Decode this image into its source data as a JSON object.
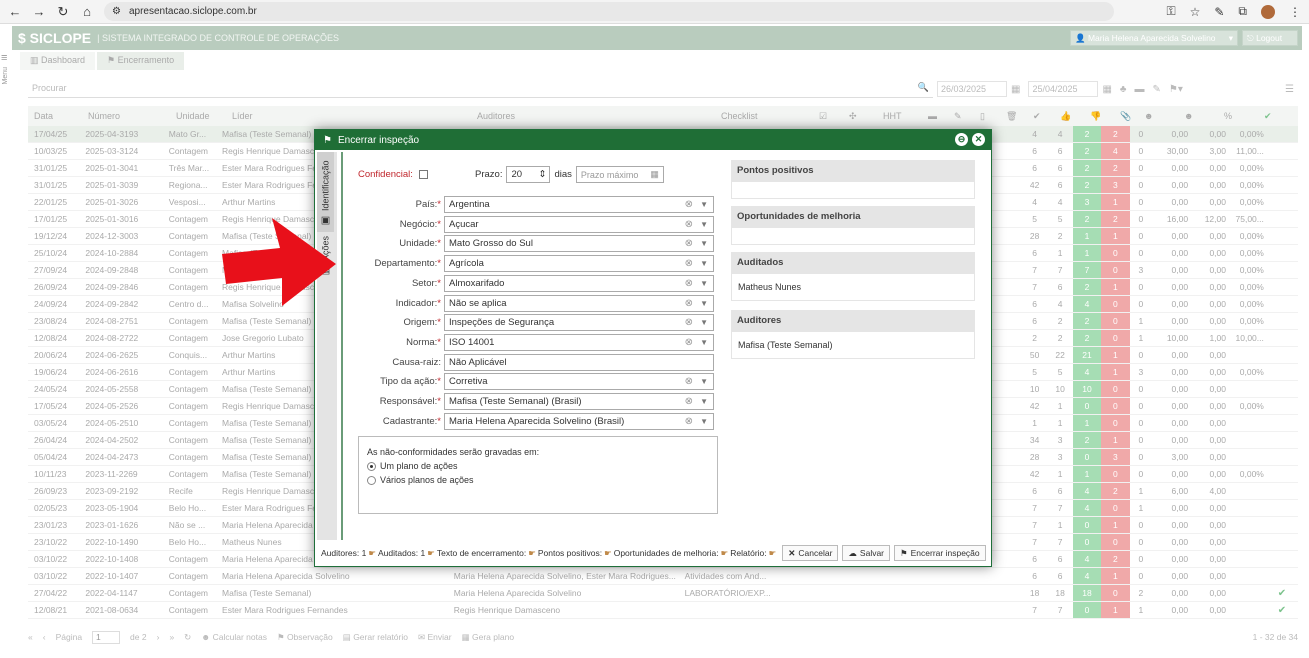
{
  "browser": {
    "url": "apresentacao.siclope.com.br"
  },
  "app": {
    "logo": "$ SICLOPE",
    "title": "| SISTEMA INTEGRADO DE CONTROLE DE OPERAÇÕES",
    "user": "Maria Helena Aparecida Solvelino",
    "logout": "Logout",
    "menu_label": "Menu"
  },
  "tabs": [
    {
      "label": "Dashboard"
    },
    {
      "label": "Encerramento"
    }
  ],
  "toolbar": {
    "search_placeholder": "Procurar",
    "date_from": "26/03/2025",
    "date_to": "25/04/2025"
  },
  "table": {
    "headers": {
      "data": "Data",
      "numero": "Número",
      "unidade": "Unidade",
      "lider": "Líder",
      "auditores": "Auditores",
      "checklist": "Checklist",
      "hht": "HHT",
      "pct": "%"
    },
    "rows": [
      {
        "data": "17/04/25",
        "num": "2025-04-3193",
        "uni": "Mato Gr...",
        "lid": "Mafisa (Teste Semanal)",
        "aud": "",
        "chk": "",
        "n1": "4",
        "n2": "4",
        "g": "2",
        "r": "2",
        "z": "0",
        "v1": "0,00",
        "v2": "0,00",
        "v3": "0,00%",
        "ok": ""
      },
      {
        "data": "10/03/25",
        "num": "2025-03-3124",
        "uni": "Contagem",
        "lid": "Regis Henrique Damasceno",
        "aud": "",
        "chk": "",
        "n1": "6",
        "n2": "6",
        "g": "2",
        "r": "4",
        "z": "0",
        "v1": "30,00",
        "v2": "3,00",
        "v3": "11,00...",
        "ok": ""
      },
      {
        "data": "31/01/25",
        "num": "2025-01-3041",
        "uni": "Três Mar...",
        "lid": "Ester Mara Rodrigues Fernandes",
        "aud": "",
        "chk": "",
        "n1": "6",
        "n2": "6",
        "g": "2",
        "r": "2",
        "z": "0",
        "v1": "0,00",
        "v2": "0,00",
        "v3": "0,00%",
        "ok": ""
      },
      {
        "data": "31/01/25",
        "num": "2025-01-3039",
        "uni": "Regiona...",
        "lid": "Ester Mara Rodrigues Fernandes",
        "aud": "",
        "chk": "",
        "n1": "42",
        "n2": "6",
        "g": "2",
        "r": "3",
        "z": "0",
        "v1": "0,00",
        "v2": "0,00",
        "v3": "0,00%",
        "ok": ""
      },
      {
        "data": "22/01/25",
        "num": "2025-01-3026",
        "uni": "Vesposi...",
        "lid": "Arthur Martins",
        "aud": "",
        "chk": "",
        "n1": "4",
        "n2": "4",
        "g": "3",
        "r": "1",
        "z": "0",
        "v1": "0,00",
        "v2": "0,00",
        "v3": "0,00%",
        "ok": ""
      },
      {
        "data": "17/01/25",
        "num": "2025-01-3016",
        "uni": "Contagem",
        "lid": "Regis Henrique Damasceno",
        "aud": "",
        "chk": "",
        "n1": "5",
        "n2": "5",
        "g": "2",
        "r": "2",
        "z": "0",
        "v1": "16,00",
        "v2": "12,00",
        "v3": "75,00...",
        "ok": ""
      },
      {
        "data": "19/12/24",
        "num": "2024-12-3003",
        "uni": "Contagem",
        "lid": "Mafisa (Teste Semanal)",
        "aud": "",
        "chk": "",
        "n1": "28",
        "n2": "2",
        "g": "1",
        "r": "1",
        "z": "0",
        "v1": "0,00",
        "v2": "0,00",
        "v3": "0,00%",
        "ok": ""
      },
      {
        "data": "25/10/24",
        "num": "2024-10-2884",
        "uni": "Contagem",
        "lid": "Mafisa (Teste Semanal)",
        "aud": "",
        "chk": "",
        "n1": "6",
        "n2": "1",
        "g": "1",
        "r": "0",
        "z": "0",
        "v1": "0,00",
        "v2": "0,00",
        "v3": "0,00%",
        "ok": ""
      },
      {
        "data": "27/09/24",
        "num": "2024-09-2848",
        "uni": "Contagem",
        "lid": "Mafisa (Teste Semanal)",
        "aud": "",
        "chk": "",
        "n1": "7",
        "n2": "7",
        "g": "7",
        "r": "0",
        "z": "3",
        "v1": "0,00",
        "v2": "0,00",
        "v3": "0,00%",
        "ok": ""
      },
      {
        "data": "26/09/24",
        "num": "2024-09-2846",
        "uni": "Contagem",
        "lid": "Regis Henrique Damasceno",
        "aud": "",
        "chk": "",
        "n1": "7",
        "n2": "6",
        "g": "2",
        "r": "1",
        "z": "0",
        "v1": "0,00",
        "v2": "0,00",
        "v3": "0,00%",
        "ok": ""
      },
      {
        "data": "24/09/24",
        "num": "2024-09-2842",
        "uni": "Centro d...",
        "lid": "Mafisa Solvelino",
        "aud": "",
        "chk": "",
        "n1": "6",
        "n2": "4",
        "g": "4",
        "r": "0",
        "z": "0",
        "v1": "0,00",
        "v2": "0,00",
        "v3": "0,00%",
        "ok": ""
      },
      {
        "data": "23/08/24",
        "num": "2024-08-2751",
        "uni": "Contagem",
        "lid": "Mafisa (Teste Semanal)",
        "aud": "",
        "chk": "",
        "n1": "6",
        "n2": "2",
        "g": "2",
        "r": "0",
        "z": "1",
        "v1": "0,00",
        "v2": "0,00",
        "v3": "0,00%",
        "ok": ""
      },
      {
        "data": "12/08/24",
        "num": "2024-08-2722",
        "uni": "Contagem",
        "lid": "Jose Gregorio Lubato",
        "aud": "",
        "chk": "",
        "n1": "2",
        "n2": "2",
        "g": "2",
        "r": "0",
        "z": "1",
        "v1": "10,00",
        "v2": "1,00",
        "v3": "10,00...",
        "ok": ""
      },
      {
        "data": "20/06/24",
        "num": "2024-06-2625",
        "uni": "Conquis...",
        "lid": "Arthur Martins",
        "aud": "",
        "chk": "",
        "n1": "50",
        "n2": "22",
        "g": "21",
        "r": "1",
        "z": "0",
        "v1": "0,00",
        "v2": "0,00",
        "v3": "",
        "ok": ""
      },
      {
        "data": "19/06/24",
        "num": "2024-06-2616",
        "uni": "Contagem",
        "lid": "Arthur Martins",
        "aud": "",
        "chk": "",
        "n1": "5",
        "n2": "5",
        "g": "4",
        "r": "1",
        "z": "3",
        "v1": "0,00",
        "v2": "0,00",
        "v3": "0,00%",
        "ok": ""
      },
      {
        "data": "24/05/24",
        "num": "2024-05-2558",
        "uni": "Contagem",
        "lid": "Mafisa (Teste Semanal)",
        "aud": "",
        "chk": "",
        "n1": "10",
        "n2": "10",
        "g": "10",
        "r": "0",
        "z": "0",
        "v1": "0,00",
        "v2": "0,00",
        "v3": "",
        "ok": ""
      },
      {
        "data": "17/05/24",
        "num": "2024-05-2526",
        "uni": "Contagem",
        "lid": "Regis Henrique Damasceno",
        "aud": "",
        "chk": "",
        "n1": "42",
        "n2": "1",
        "g": "0",
        "r": "0",
        "z": "0",
        "v1": "0,00",
        "v2": "0,00",
        "v3": "0,00%",
        "ok": ""
      },
      {
        "data": "03/05/24",
        "num": "2024-05-2510",
        "uni": "Contagem",
        "lid": "Mafisa (Teste Semanal)",
        "aud": "",
        "chk": "",
        "n1": "1",
        "n2": "1",
        "g": "1",
        "r": "0",
        "z": "0",
        "v1": "0,00",
        "v2": "0,00",
        "v3": "",
        "ok": ""
      },
      {
        "data": "26/04/24",
        "num": "2024-04-2502",
        "uni": "Contagem",
        "lid": "Mafisa (Teste Semanal)",
        "aud": "",
        "chk": "",
        "n1": "34",
        "n2": "3",
        "g": "2",
        "r": "1",
        "z": "0",
        "v1": "0,00",
        "v2": "0,00",
        "v3": "",
        "ok": ""
      },
      {
        "data": "05/04/24",
        "num": "2024-04-2473",
        "uni": "Contagem",
        "lid": "Mafisa (Teste Semanal)",
        "aud": "",
        "chk": "",
        "n1": "28",
        "n2": "3",
        "g": "0",
        "r": "3",
        "z": "0",
        "v1": "3,00",
        "v2": "0,00",
        "v3": "",
        "ok": ""
      },
      {
        "data": "10/11/23",
        "num": "2023-11-2269",
        "uni": "Contagem",
        "lid": "Mafisa (Teste Semanal)",
        "aud": "",
        "chk": "",
        "n1": "42",
        "n2": "1",
        "g": "1",
        "r": "0",
        "z": "0",
        "v1": "0,00",
        "v2": "0,00",
        "v3": "0,00%",
        "ok": ""
      },
      {
        "data": "26/09/23",
        "num": "2023-09-2192",
        "uni": "Recife",
        "lid": "Regis Henrique Damasceno",
        "aud": "",
        "chk": "",
        "n1": "6",
        "n2": "6",
        "g": "4",
        "r": "2",
        "z": "1",
        "v1": "6,00",
        "v2": "4,00",
        "v3": "",
        "ok": ""
      },
      {
        "data": "02/05/23",
        "num": "2023-05-1904",
        "uni": "Belo Ho...",
        "lid": "Ester Mara Rodrigues Fernandes",
        "aud": "",
        "chk": "",
        "n1": "7",
        "n2": "7",
        "g": "4",
        "r": "0",
        "z": "1",
        "v1": "0,00",
        "v2": "0,00",
        "v3": "",
        "ok": ""
      },
      {
        "data": "23/01/23",
        "num": "2023-01-1626",
        "uni": "Não se ...",
        "lid": "Maria Helena Aparecida Solvelino",
        "aud": "",
        "chk": "",
        "n1": "7",
        "n2": "1",
        "g": "0",
        "r": "1",
        "z": "0",
        "v1": "0,00",
        "v2": "0,00",
        "v3": "",
        "ok": ""
      },
      {
        "data": "23/10/22",
        "num": "2022-10-1490",
        "uni": "Belo Ho...",
        "lid": "Matheus Nunes",
        "aud": "",
        "chk": "",
        "n1": "7",
        "n2": "7",
        "g": "0",
        "r": "0",
        "z": "0",
        "v1": "0,00",
        "v2": "0,00",
        "v3": "",
        "ok": ""
      },
      {
        "data": "03/10/22",
        "num": "2022-10-1408",
        "uni": "Contagem",
        "lid": "Maria Helena Aparecida Solvelino",
        "aud": "",
        "chk": "",
        "n1": "6",
        "n2": "6",
        "g": "4",
        "r": "2",
        "z": "0",
        "v1": "0,00",
        "v2": "0,00",
        "v3": "",
        "ok": ""
      },
      {
        "data": "03/10/22",
        "num": "2022-10-1407",
        "uni": "Contagem",
        "lid": "Maria Helena Aparecida Solvelino",
        "aud": "Maria Helena Aparecida Solvelino, Ester Mara Rodrigues...",
        "chk": "Atividades com And...",
        "n1": "6",
        "n2": "6",
        "g": "4",
        "r": "1",
        "z": "0",
        "v1": "0,00",
        "v2": "0,00",
        "v3": "",
        "ok": ""
      },
      {
        "data": "27/04/22",
        "num": "2022-04-1147",
        "uni": "Contagem",
        "lid": "Mafisa (Teste Semanal)",
        "aud": "Maria Helena Aparecida Solvelino",
        "chk": "LABORATÓRIO/EXP...",
        "n1": "18",
        "n2": "18",
        "g": "18",
        "r": "0",
        "z": "2",
        "v1": "0,00",
        "v2": "0,00",
        "v3": "",
        "ok": "✔"
      },
      {
        "data": "12/08/21",
        "num": "2021-08-0634",
        "uni": "Contagem",
        "lid": "Ester Mara Rodrigues Fernandes",
        "aud": "Regis Henrique Damasceno",
        "chk": "",
        "n1": "7",
        "n2": "7",
        "g": "0",
        "r": "1",
        "z": "1",
        "v1": "0,00",
        "v2": "0,00",
        "v3": "",
        "ok": "✔"
      }
    ]
  },
  "footer": {
    "pagina": "Página",
    "page": "1",
    "de": "de 2",
    "calc": "Calcular notas",
    "obs": "Observação",
    "gerar_rel": "Gerar relatório",
    "enviar": "Enviar",
    "gerar_plano": "Gera plano",
    "count": "1 - 32 de 34"
  },
  "modal": {
    "title": "Encerrar inspeção",
    "tab_ident": "Identificação",
    "tab_acoes": "Ações",
    "confidencial": "Confidencial:",
    "prazo_label": "Prazo:",
    "prazo_value": "20",
    "dias": "dias",
    "prazo_max": "Prazo máximo",
    "fields": [
      {
        "label": "País:",
        "value": "Argentina",
        "req": true,
        "sel": true
      },
      {
        "label": "Negócio:",
        "value": "Açucar",
        "req": true,
        "sel": true
      },
      {
        "label": "Unidade:",
        "value": "Mato Grosso do Sul",
        "req": true,
        "sel": true
      },
      {
        "label": "Departamento:",
        "value": "Agrícola",
        "req": true,
        "sel": true
      },
      {
        "label": "Setor:",
        "value": "Almoxarifado",
        "req": true,
        "sel": true
      },
      {
        "label": "Indicador:",
        "value": "Não se aplica",
        "req": true,
        "sel": true
      },
      {
        "label": "Origem:",
        "value": "Inspeções de Segurança",
        "req": true,
        "sel": true
      },
      {
        "label": "Norma:",
        "value": "ISO 14001",
        "req": true,
        "sel": true
      },
      {
        "label": "Causa-raiz:",
        "value": "Não Aplicável",
        "req": false,
        "sel": false
      },
      {
        "label": "Tipo da ação:",
        "value": "Corretiva",
        "req": true,
        "sel": true
      },
      {
        "label": "Responsável:",
        "value": "Mafisa (Teste Semanal) (Brasil)",
        "req": true,
        "sel": true
      },
      {
        "label": "Cadastrante:",
        "value": "Maria Helena Aparecida Solvelino (Brasil)",
        "req": true,
        "sel": true
      }
    ],
    "nc_title": "As não-conformidades serão gravadas em:",
    "nc_opt1": "Um plano de ações",
    "nc_opt2": "Vários planos de ações",
    "panels": [
      {
        "title": "Pontos positivos",
        "body": ""
      },
      {
        "title": "Oportunidades de melhoria",
        "body": ""
      },
      {
        "title": "Auditados",
        "body": "Matheus Nunes"
      },
      {
        "title": "Auditores",
        "body": "Mafisa (Teste Semanal)"
      }
    ],
    "foot": {
      "auditores": "Auditores: 1",
      "auditados": "Auditados: 1",
      "texto": "Texto de encerramento:",
      "pontos": "Pontos positivos:",
      "oport": "Oportunidades de melhoria:",
      "relatorio": "Relatório:",
      "cancel": "Cancelar",
      "save": "Salvar",
      "close": "Encerrar inspeção"
    }
  },
  "colors": {
    "green": "#1f6e36",
    "red": "#e8101a"
  }
}
